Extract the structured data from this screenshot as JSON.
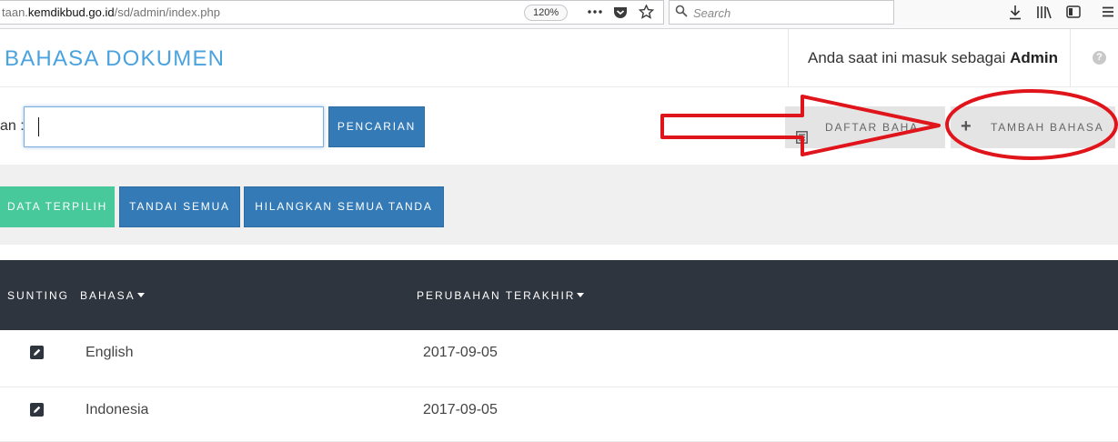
{
  "browser": {
    "url_prefix": "taan.",
    "url_domain": "kemdikbud.go.id",
    "url_path": "/sd/admin/index.php",
    "zoom": "120%",
    "search_placeholder": "Search"
  },
  "header": {
    "title": "BAHASA DOKUMEN",
    "user_prefix": "Anda saat ini masuk sebagai",
    "user_name": "Admin",
    "help": "?"
  },
  "search": {
    "label": "an :",
    "value": "",
    "button": "PENCARIAN"
  },
  "toolbar": {
    "list_button": "DAFTAR BAHA",
    "add_button": "TAMBAH BAHASA"
  },
  "actions": {
    "delete_selected": "DATA TERPILIH",
    "mark_all": "TANDAI SEMUA",
    "unmark_all": "HILANGKAN SEMUA TANDA"
  },
  "table": {
    "columns": [
      "SUNTING",
      "BAHASA",
      "PERUBAHAN TERAKHIR"
    ],
    "rows": [
      {
        "language": "English",
        "updated": "2017-09-05"
      },
      {
        "language": "Indonesia",
        "updated": "2017-09-05"
      }
    ]
  },
  "colors": {
    "title": "#4aa3df",
    "primary": "#337ab7",
    "success": "#48c99b",
    "table_header": "#2f353f",
    "annotation": "#e0141b"
  },
  "icons": [
    "search-icon",
    "download-icon",
    "library-icon",
    "sidebar-icon",
    "menu-icon",
    "pocket-icon",
    "bookmark-star-icon",
    "more-icon",
    "help-icon",
    "list-icon",
    "plus-icon",
    "edit-icon"
  ]
}
